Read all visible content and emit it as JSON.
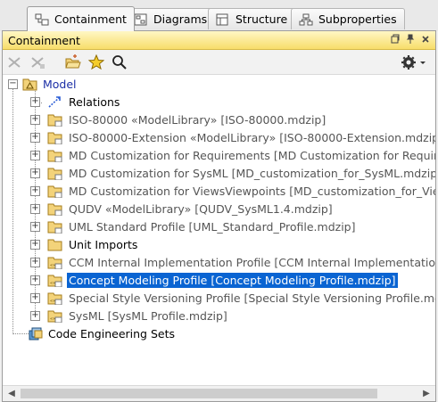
{
  "tabs": [
    {
      "label": "Containment",
      "active": true
    },
    {
      "label": "Diagrams",
      "active": false
    },
    {
      "label": "Structure",
      "active": false
    },
    {
      "label": "Subproperties",
      "active": false
    }
  ],
  "panel": {
    "title": "Containment"
  },
  "tree": {
    "root": "Model",
    "items": [
      {
        "label": "Relations",
        "icon": "relations-icon",
        "style": "normal"
      },
      {
        "label": "ISO-80000 «ModelLibrary» [ISO-80000.mdzip]",
        "icon": "package-icon",
        "style": "grey"
      },
      {
        "label": "ISO-80000-Extension «ModelLibrary» [ISO-80000-Extension.mdzip]",
        "icon": "package-icon",
        "style": "grey"
      },
      {
        "label": "MD Customization for Requirements [MD Customization for Requirement",
        "icon": "package-icon",
        "style": "grey"
      },
      {
        "label": "MD Customization for SysML [MD_customization_for_SysML.mdzip]",
        "icon": "package-icon",
        "style": "grey"
      },
      {
        "label": "MD Customization for ViewsViewpoints [MD_customization_for_ViewsVie",
        "icon": "package-icon",
        "style": "grey"
      },
      {
        "label": "QUDV «ModelLibrary» [QUDV_SysML1.4.mdzip]",
        "icon": "package-icon",
        "style": "grey"
      },
      {
        "label": "UML Standard Profile [UML_Standard_Profile.mdzip]",
        "icon": "package-icon",
        "style": "grey"
      },
      {
        "label": "Unit Imports",
        "icon": "package-icon",
        "style": "normal"
      },
      {
        "label": "CCM Internal Implementation Profile [CCM Internal Implementation Prof",
        "icon": "profile-icon",
        "style": "grey"
      },
      {
        "label": "Concept Modeling Profile [Concept Modeling Profile.mdzip]",
        "icon": "profile-icon",
        "style": "selected"
      },
      {
        "label": "Special Style Versioning Profile [Special Style Versioning Profile.mdzip]",
        "icon": "profile-icon",
        "style": "grey"
      },
      {
        "label": "SysML [SysML Profile.mdzip]",
        "icon": "profile-icon",
        "style": "grey"
      }
    ],
    "footer_item": "Code Engineering Sets"
  },
  "colors": {
    "selection": "#0a64d2",
    "titlebar": "#f7dd6a",
    "folder": "#f3d37a"
  }
}
